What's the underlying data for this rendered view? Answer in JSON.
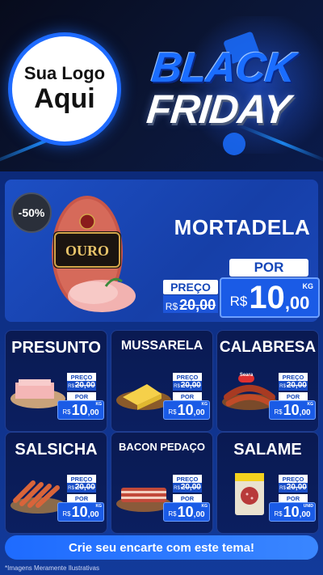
{
  "header": {
    "logo_line1": "Sua Logo",
    "logo_line2": "Aqui",
    "title_line1": "BLACK",
    "title_line2": "FRIDAY"
  },
  "hero": {
    "discount": "-50%",
    "brand": "OURO",
    "name": "MORTADELA",
    "preco_label": "PREÇO",
    "old_currency": "R$",
    "old_price": "20,00",
    "por_label": "POR",
    "currency": "R$",
    "price_int": "10",
    "price_dec": ",00",
    "unit": "KG"
  },
  "products": [
    {
      "name": "PRESUNTO",
      "preco_label": "PREÇO",
      "old_currency": "R$",
      "old_price": "20,00",
      "por_label": "POR",
      "currency": "R$",
      "price_int": "10",
      "price_dec": ",00",
      "unit": "KG",
      "icon": "ham-icon"
    },
    {
      "name": "MUSSARELA",
      "preco_label": "PREÇO",
      "old_currency": "R$",
      "old_price": "20,00",
      "por_label": "POR",
      "currency": "R$",
      "price_int": "10",
      "price_dec": ",00",
      "unit": "KG",
      "icon": "cheese-icon"
    },
    {
      "name": "CALABRESA",
      "preco_label": "PREÇO",
      "old_currency": "R$",
      "old_price": "20,00",
      "por_label": "POR",
      "currency": "R$",
      "price_int": "10",
      "price_dec": ",00",
      "unit": "KG",
      "brand": "Seara",
      "icon": "sausage-icon"
    },
    {
      "name": "SALSICHA",
      "preco_label": "PREÇO",
      "old_currency": "R$",
      "old_price": "20,00",
      "por_label": "POR",
      "currency": "R$",
      "price_int": "10",
      "price_dec": ",00",
      "unit": "KG",
      "icon": "hotdog-icon"
    },
    {
      "name": "BACON PEDAÇO",
      "preco_label": "PREÇO",
      "old_currency": "R$",
      "old_price": "20,00",
      "por_label": "POR",
      "currency": "R$",
      "price_int": "10",
      "price_dec": ",00",
      "unit": "KG",
      "icon": "bacon-icon"
    },
    {
      "name": "SALAME",
      "preco_label": "PREÇO",
      "old_currency": "R$",
      "old_price": "20,00",
      "por_label": "POR",
      "currency": "R$",
      "price_int": "10",
      "price_dec": ",00",
      "unit": "UNID",
      "icon": "salami-icon"
    }
  ],
  "cta": "Crie seu encarte com este tema!",
  "disclaimer": "*Imagens Meramente Ilustrativas",
  "colors": {
    "accent": "#1a5be6",
    "background": "#0c2a7a",
    "card": "#0a1a52",
    "text_highlight": "#1446b8"
  }
}
